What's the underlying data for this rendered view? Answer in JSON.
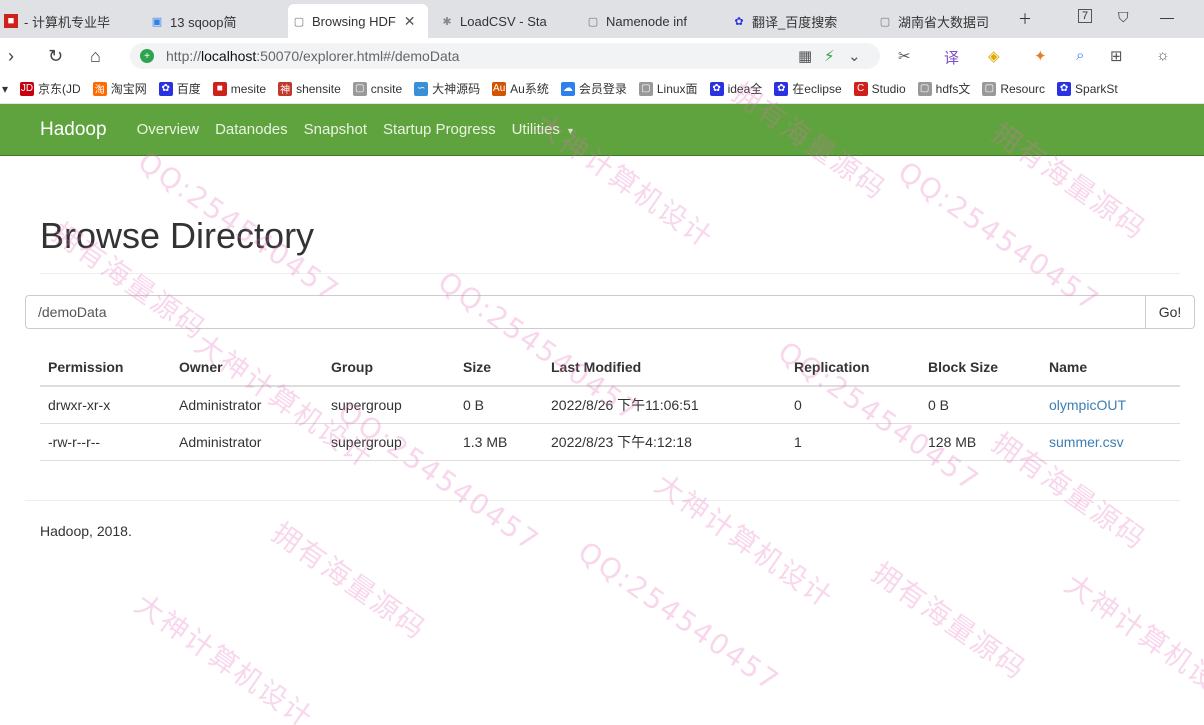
{
  "browser": {
    "tabs": [
      {
        "title": "- 计算机专业毕",
        "active": false
      },
      {
        "title": "13 sqoop简",
        "active": false
      },
      {
        "title": "Browsing HDF",
        "active": true
      },
      {
        "title": "LoadCSV - Sta",
        "active": false
      },
      {
        "title": "Namenode inf",
        "active": false
      },
      {
        "title": "翻译_百度搜索",
        "active": false
      },
      {
        "title": "湖南省大数据司",
        "active": false
      }
    ],
    "tab_badge": "7",
    "url": {
      "scheme": "http://",
      "host": "localhost",
      "rest": ":50070/explorer.html#/demoData"
    },
    "bookmarks": [
      {
        "label": "京东(JD",
        "color": "#c7000b",
        "icon": "JD"
      },
      {
        "label": "淘宝网",
        "color": "#ff6a00",
        "icon": "淘"
      },
      {
        "label": "百度",
        "color": "#2932e1",
        "icon": "✿"
      },
      {
        "label": "mesite",
        "color": "#d0201a",
        "icon": "■"
      },
      {
        "label": "shensite",
        "color": "#c0392b",
        "icon": "神"
      },
      {
        "label": "cnsite",
        "color": "#999999",
        "icon": "▢"
      },
      {
        "label": "大神源码",
        "color": "#3a8fd9",
        "icon": "∽"
      },
      {
        "label": "Au系统",
        "color": "#d35400",
        "icon": "Au"
      },
      {
        "label": "会员登录",
        "color": "#2f80ed",
        "icon": "☁"
      },
      {
        "label": "Linux面",
        "color": "#999999",
        "icon": "▢"
      },
      {
        "label": "idea全",
        "color": "#2932e1",
        "icon": "✿"
      },
      {
        "label": "在eclipse",
        "color": "#2932e1",
        "icon": "✿"
      },
      {
        "label": "Studio",
        "color": "#d0201a",
        "icon": "C"
      },
      {
        "label": "hdfs文",
        "color": "#999999",
        "icon": "▢"
      },
      {
        "label": "Resourc",
        "color": "#999999",
        "icon": "▢"
      },
      {
        "label": "SparkSt",
        "color": "#2932e1",
        "icon": "✿"
      }
    ]
  },
  "navbar": {
    "brand": "Hadoop",
    "links": [
      "Overview",
      "Datanodes",
      "Snapshot",
      "Startup Progress",
      "Utilities"
    ]
  },
  "page": {
    "title": "Browse Directory",
    "path_value": "/demoData",
    "go_label": "Go!"
  },
  "table": {
    "headers": [
      "Permission",
      "Owner",
      "Group",
      "Size",
      "Last Modified",
      "Replication",
      "Block Size",
      "Name"
    ],
    "rows": [
      [
        "drwxr-xr-x",
        "Administrator",
        "supergroup",
        "0 B",
        "2022/8/26 下午11:06:51",
        "0",
        "0 B",
        "olympicOUT"
      ],
      [
        "-rw-r--r--",
        "Administrator",
        "supergroup",
        "1.3 MB",
        "2022/8/23 下午4:12:18",
        "1",
        "128 MB",
        "summer.csv"
      ]
    ]
  },
  "footer": "Hadoop, 2018.",
  "watermark": {
    "lines": [
      "大神计算机设计",
      "QQ:254540457",
      "拥有海量源码"
    ]
  },
  "colors": {
    "navbar": "#5fa33e",
    "link": "#3d7eb3",
    "watermark": "#e66ebe"
  }
}
